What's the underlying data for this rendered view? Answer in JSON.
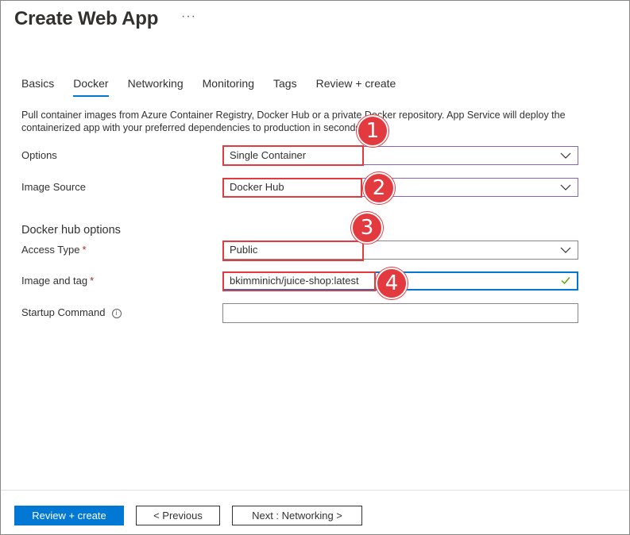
{
  "page": {
    "title": "Create Web App",
    "more_label": "···"
  },
  "tabs": [
    {
      "label": "Basics",
      "active": false
    },
    {
      "label": "Docker",
      "active": true
    },
    {
      "label": "Networking",
      "active": false
    },
    {
      "label": "Monitoring",
      "active": false
    },
    {
      "label": "Tags",
      "active": false
    },
    {
      "label": "Review + create",
      "active": false
    }
  ],
  "description": "Pull container images from Azure Container Registry, Docker Hub or a private Docker repository. App Service will deploy the containerized app with your preferred dependencies to production in seconds.",
  "form": {
    "options": {
      "label": "Options",
      "value": "Single Container",
      "icon": "chevron-down-icon"
    },
    "image_source": {
      "label": "Image Source",
      "value": "Docker Hub",
      "icon": "chevron-down-icon"
    },
    "section_title": "Docker hub options",
    "access_type": {
      "label": "Access Type",
      "required_mark": "*",
      "value": "Public",
      "icon": "chevron-down-icon"
    },
    "image_and_tag": {
      "label": "Image and tag",
      "required_mark": "*",
      "value": "bkimminich/juice-shop:latest",
      "icon": "checkmark-icon"
    },
    "startup_command": {
      "label": "Startup Command",
      "info_glyph": "i",
      "value": ""
    }
  },
  "annotations": {
    "badge_1": "1",
    "badge_2": "2",
    "badge_3": "3",
    "badge_4": "4"
  },
  "footer": {
    "review_create_label": "Review + create",
    "previous_label": "< Previous",
    "next_label": "Next : Networking >"
  },
  "colors": {
    "accent": "#0078d4",
    "annotation_red": "#e23a3f",
    "dropdown_border_purple": "#8764b8",
    "success_green": "#57a300",
    "required_red": "#a4262c"
  }
}
